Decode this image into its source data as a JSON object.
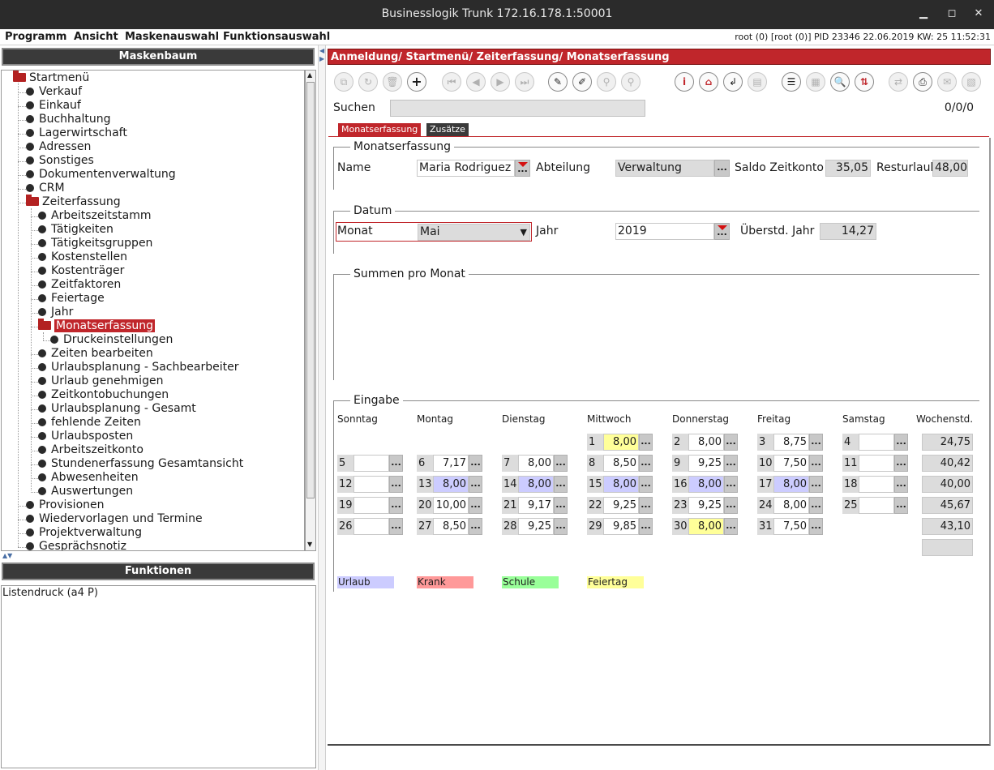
{
  "window": {
    "title": "Businesslogik Trunk 172.16.178.1:50001"
  },
  "menubar": {
    "items": [
      "Programm",
      "Ansicht",
      "Maskenauswahl",
      "Funktionsauswahl"
    ],
    "status": "root (0) [root (0)] PID 23346  22.06.2019 KW: 25  11:52:31"
  },
  "left": {
    "tree_header": "Maskenbaum",
    "functions_header": "Funktionen",
    "functions": [
      "Listendruck (a4 P)"
    ],
    "tree": {
      "root": "Startmenü",
      "level1a": [
        "Verkauf",
        "Einkauf",
        "Buchhaltung",
        "Lagerwirtschaft",
        "Adressen",
        "Sonstiges",
        "Dokumentenverwaltung",
        "CRM"
      ],
      "zeiterfassung": "Zeiterfassung",
      "level2a": [
        "Arbeitszeitstamm",
        "Tätigkeiten",
        "Tätigkeitsgruppen",
        "Kostenstellen",
        "Kostenträger",
        "Zeitfaktoren",
        "Feiertage",
        "Jahr"
      ],
      "selected": "Monatserfassung",
      "level3": "Druckeinstellungen",
      "level2b": [
        "Zeiten bearbeiten",
        "Urlaubsplanung - Sachbearbeiter",
        "Urlaub genehmigen",
        "Zeitkontobuchungen",
        "Urlaubsplanung - Gesamt",
        "fehlende Zeiten",
        "Urlaubsposten",
        "Arbeitszeitkonto",
        "Stundenerfassung Gesamtansicht",
        "Abwesenheiten",
        "Auswertungen"
      ],
      "level1b": [
        "Provisionen",
        "Wiedervorlagen und Termine",
        "Projektverwaltung",
        "Gesprächsnotiz"
      ]
    }
  },
  "breadcrumb": "Anmeldung/ Startmenü/ Zeiterfassung/ Monatserfassung",
  "search": {
    "label": "Suchen",
    "value": "",
    "count": "0/0/0"
  },
  "tabs": [
    "Monatserfassung",
    "Zusätze"
  ],
  "monatserfassung": {
    "title": "Monatserfassung",
    "name_label": "Name",
    "name_value": "Maria Rodriguez",
    "abteilung_label": "Abteilung",
    "abteilung_value": "Verwaltung",
    "saldo_label": "Saldo Zeitkonto",
    "saldo_value": "35,05",
    "resturlaub_label": "Resturlaub",
    "resturlaub_value": "48,00"
  },
  "datum": {
    "title": "Datum",
    "monat_label": "Monat",
    "monat_value": "Mai",
    "jahr_label": "Jahr",
    "jahr_value": "2019",
    "ueberstd_label": "Überstd. Jahr",
    "ueberstd_value": "14,27"
  },
  "summen": {
    "title": "Summen pro Monat"
  },
  "eingabe": {
    "title": "Eingabe",
    "days": [
      "Sonntag",
      "Montag",
      "Dienstag",
      "Mittwoch",
      "Donnerstag",
      "Freitag",
      "Samstag"
    ],
    "weekly_label": "Wochenstd.",
    "weeks": [
      [
        null,
        null,
        null,
        {
          "d": "1",
          "v": "8,00",
          "t": "feiertag"
        },
        {
          "d": "2",
          "v": "8,00"
        },
        {
          "d": "3",
          "v": "8,75"
        },
        {
          "d": "4",
          "v": ""
        }
      ],
      [
        {
          "d": "5",
          "v": ""
        },
        {
          "d": "6",
          "v": "7,17"
        },
        {
          "d": "7",
          "v": "8,00"
        },
        {
          "d": "8",
          "v": "8,50"
        },
        {
          "d": "9",
          "v": "9,25"
        },
        {
          "d": "10",
          "v": "7,50"
        },
        {
          "d": "11",
          "v": ""
        }
      ],
      [
        {
          "d": "12",
          "v": ""
        },
        {
          "d": "13",
          "v": "8,00",
          "t": "urlaub"
        },
        {
          "d": "14",
          "v": "8,00",
          "t": "urlaub"
        },
        {
          "d": "15",
          "v": "8,00",
          "t": "urlaub"
        },
        {
          "d": "16",
          "v": "8,00",
          "t": "urlaub"
        },
        {
          "d": "17",
          "v": "8,00",
          "t": "urlaub"
        },
        {
          "d": "18",
          "v": ""
        }
      ],
      [
        {
          "d": "19",
          "v": ""
        },
        {
          "d": "20",
          "v": "10,00"
        },
        {
          "d": "21",
          "v": "9,17"
        },
        {
          "d": "22",
          "v": "9,25"
        },
        {
          "d": "23",
          "v": "9,25"
        },
        {
          "d": "24",
          "v": "8,00"
        },
        {
          "d": "25",
          "v": ""
        }
      ],
      [
        {
          "d": "26",
          "v": ""
        },
        {
          "d": "27",
          "v": "8,50"
        },
        {
          "d": "28",
          "v": "9,25"
        },
        {
          "d": "29",
          "v": "9,85"
        },
        {
          "d": "30",
          "v": "8,00",
          "t": "feiertag"
        },
        {
          "d": "31",
          "v": "7,50"
        },
        null
      ]
    ],
    "weekly_totals": [
      "24,75",
      "40,42",
      "40,00",
      "45,67",
      "43,10",
      ""
    ],
    "legend": [
      {
        "label": "Urlaub",
        "color": "#ccccff"
      },
      {
        "label": "Krank",
        "color": "#ff9999"
      },
      {
        "label": "Schule",
        "color": "#99ff99"
      },
      {
        "label": "Feiertag",
        "color": "#ffff99"
      }
    ]
  },
  "colors": {
    "accent": "#c0262b",
    "urlaub": "#ccccff",
    "feiertag": "#ffff99"
  }
}
